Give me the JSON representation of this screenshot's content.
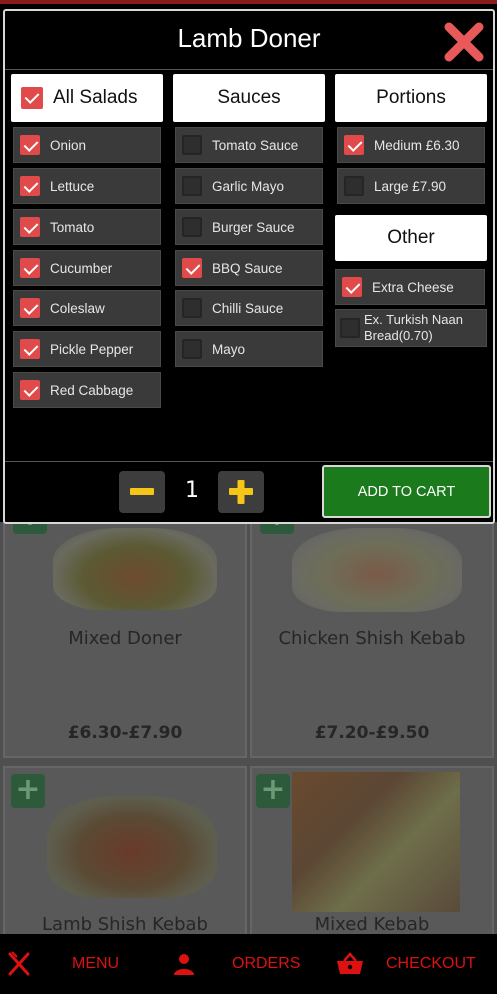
{
  "modal": {
    "title": "Lamb Doner",
    "quantity": "1",
    "add_to_cart_label": "ADD TO CART",
    "salads": {
      "header": "All Salads",
      "header_checked": true,
      "items": [
        {
          "label": "Onion",
          "checked": true
        },
        {
          "label": "Lettuce",
          "checked": true
        },
        {
          "label": "Tomato",
          "checked": true
        },
        {
          "label": "Cucumber",
          "checked": true
        },
        {
          "label": "Coleslaw",
          "checked": true
        },
        {
          "label": "Pickle Pepper",
          "checked": true
        },
        {
          "label": "Red Cabbage",
          "checked": true
        }
      ]
    },
    "sauces": {
      "header": "Sauces",
      "items": [
        {
          "label": "Tomato Sauce",
          "checked": false
        },
        {
          "label": "Garlic Mayo",
          "checked": false
        },
        {
          "label": "Burger Sauce",
          "checked": false
        },
        {
          "label": "BBQ Sauce",
          "checked": true
        },
        {
          "label": "Chilli Sauce",
          "checked": false
        },
        {
          "label": "Mayo",
          "checked": false
        }
      ]
    },
    "portions": {
      "header": "Portions",
      "items": [
        {
          "label": "Medium £6.30",
          "checked": true
        },
        {
          "label": "Large £7.90",
          "checked": false
        }
      ]
    },
    "other": {
      "header": "Other",
      "items": [
        {
          "label": "Extra Cheese",
          "checked": true
        },
        {
          "label": "Ex. Turkish Naan Bread(0.70)",
          "checked": false
        }
      ]
    }
  },
  "menu_items": [
    {
      "name": "Mixed Doner",
      "price": "£6.30-£7.90"
    },
    {
      "name": "Chicken Shish Kebab",
      "price": "£7.20-£9.50"
    },
    {
      "name": "Lamb Shish Kebab",
      "price": ""
    },
    {
      "name": "Mixed Kebab",
      "price": ""
    }
  ],
  "nav": {
    "menu": "MENU",
    "orders": "ORDERS",
    "checkout": "CHECKOUT"
  },
  "colors": {
    "accent_red": "#e04a4a",
    "nav_red": "#dd1111",
    "add_cart_green": "#1b7a1b",
    "stepper_yellow": "#f5c518"
  },
  "icons": {
    "close": "close-x-icon",
    "minus": "minus-icon",
    "plus": "plus-icon",
    "menu": "fork-knife-icon",
    "orders": "person-icon",
    "checkout": "basket-icon"
  }
}
